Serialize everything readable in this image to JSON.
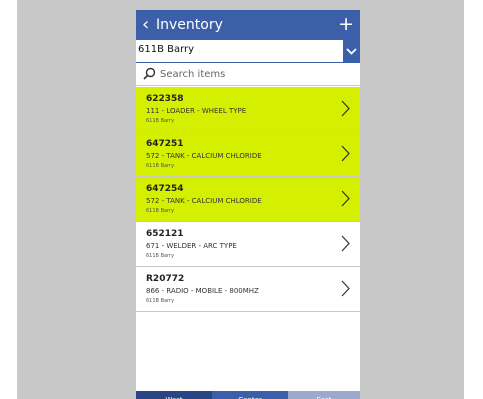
{
  "header": {
    "title": "Inventory",
    "back_icon": "chevron-left-icon",
    "add_icon": "plus-icon"
  },
  "dropdown": {
    "value": "611B Barry",
    "icon": "chevron-down-icon"
  },
  "search": {
    "placeholder": "Search items",
    "icon": "search-icon"
  },
  "items": [
    {
      "id": "622358",
      "description": "111 - LOADER - WHEEL TYPE",
      "location": "611B Barry",
      "highlighted": true
    },
    {
      "id": "647251",
      "description": "572 - TANK - CALCIUM CHLORIDE",
      "location": "611B Barry",
      "highlighted": true
    },
    {
      "id": "647254",
      "description": "572 - TANK - CALCIUM CHLORIDE",
      "location": "611B Barry",
      "highlighted": true
    },
    {
      "id": "652121",
      "description": "671 - WELDER - ARC TYPE",
      "location": "611B Barry",
      "highlighted": false
    },
    {
      "id": "R20772",
      "description": "866 - RADIO - MOBILE - 800MHZ",
      "location": "611B Barry",
      "highlighted": false
    }
  ],
  "bottom_nav": {
    "tabs": [
      {
        "label": "West",
        "color": "#2a4583"
      },
      {
        "label": "Center",
        "color": "#3b5fa8"
      },
      {
        "label": "East",
        "color": "#9aa9cc"
      }
    ]
  },
  "colors": {
    "header": "#3b5fa8",
    "highlight": "#d4f000",
    "background": "#c8c8c8"
  }
}
